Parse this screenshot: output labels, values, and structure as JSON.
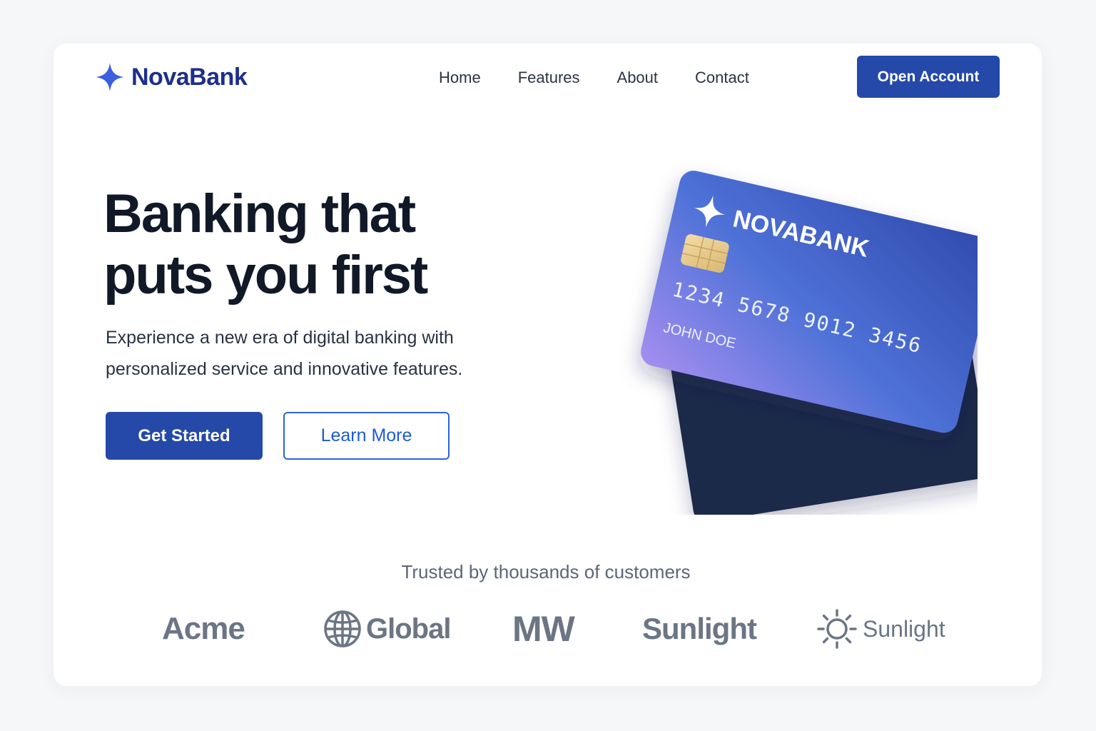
{
  "brand": {
    "name": "NovaBank",
    "accent": "#2549a8",
    "logo_icon": "four-point-star-icon"
  },
  "nav": {
    "items": [
      {
        "label": "Home"
      },
      {
        "label": "Features"
      },
      {
        "label": "About"
      },
      {
        "label": "Contact"
      }
    ],
    "cta_label": "Open Account"
  },
  "hero": {
    "title_line1": "Banking that",
    "title_line2": "puts you first",
    "subtitle": "Experience a new era of digital banking with personalized service and innovative features.",
    "primary_cta": "Get Started",
    "secondary_cta": "Learn More"
  },
  "card": {
    "bank_name": "NOVABANK",
    "number": "1234 5678 9012 3456",
    "holder": "JOHN DOE",
    "gradient_start": "#9a8cf0",
    "gradient_end": "#2f4db0",
    "back_color": "#1f2b49"
  },
  "trusted": {
    "heading": "Trusted by thousands of customers",
    "logos": [
      {
        "label": "Acme",
        "icon": ""
      },
      {
        "label": "Global",
        "icon": "globe-icon"
      },
      {
        "label": "MW",
        "icon": ""
      },
      {
        "label": "Sunlight",
        "icon": ""
      },
      {
        "label": "Sunlight",
        "icon": "sun-icon"
      }
    ]
  }
}
